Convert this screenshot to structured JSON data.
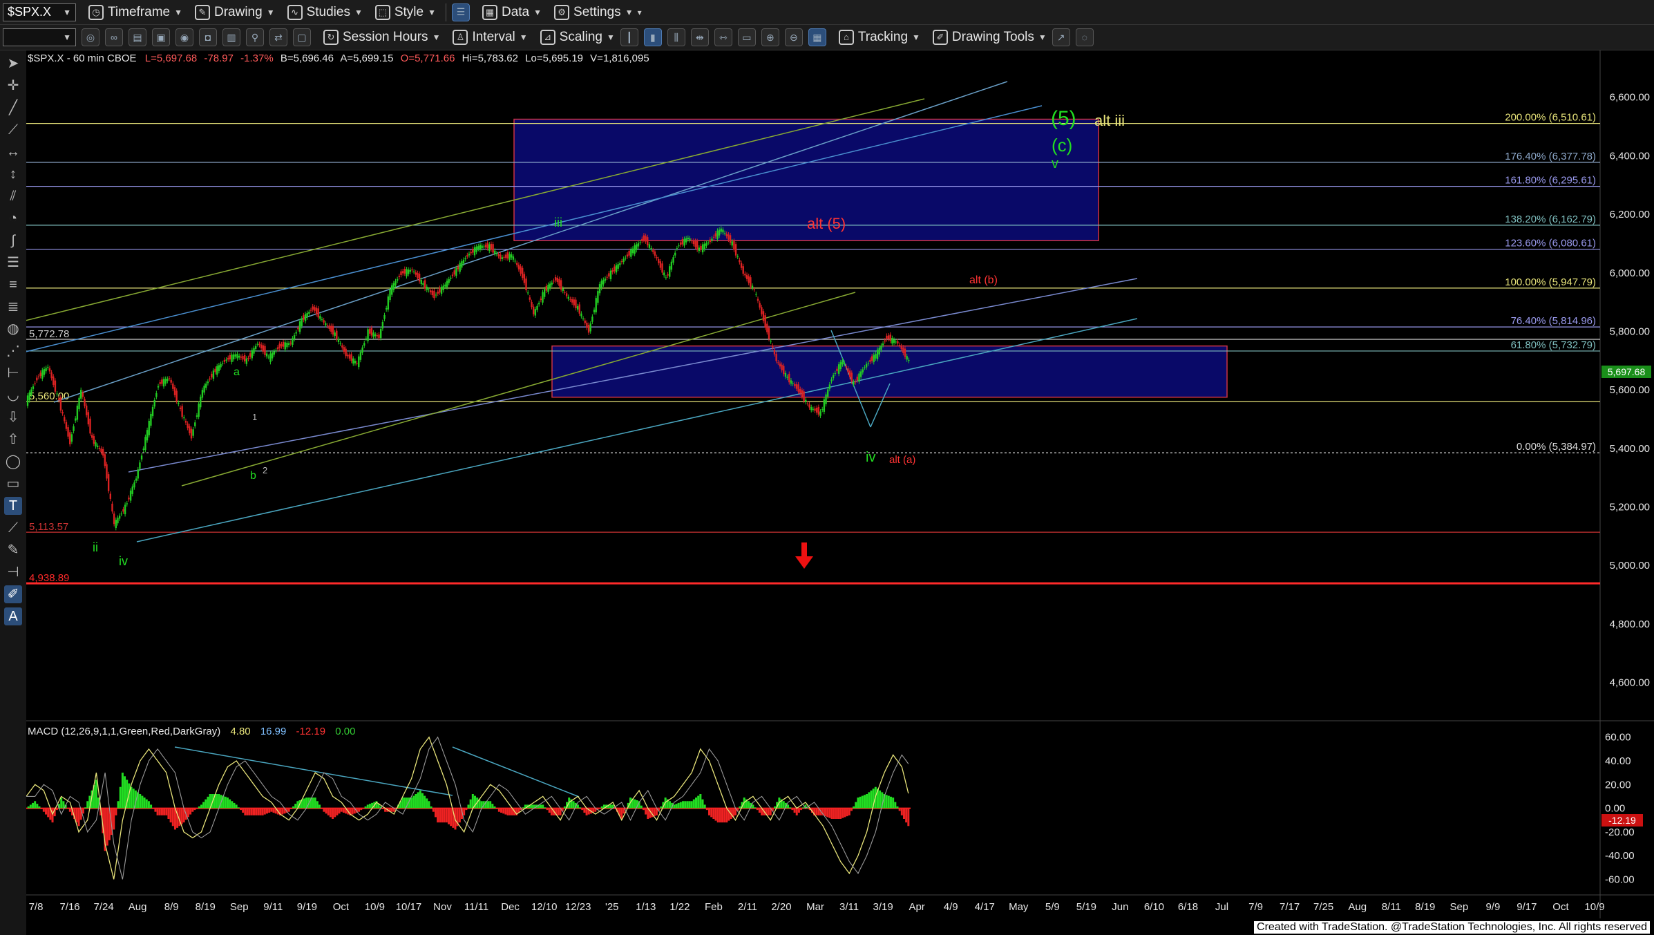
{
  "toolbar1": {
    "symbol": "$SPX.X",
    "items": [
      "Timeframe",
      "Drawing",
      "Studies",
      "Style",
      "Data",
      "Settings"
    ]
  },
  "toolbar2": {
    "items": [
      "Session Hours",
      "Interval",
      "Scaling",
      "Tracking",
      "Drawing Tools"
    ]
  },
  "footer": "Created with TradeStation. @TradeStation Technologies, Inc. All rights reserved",
  "chart_data": [
    {
      "type": "line",
      "title": "$SPX.X - 60 min  CBOE",
      "quote": {
        "L": "5,697.68",
        "chg": "-78.97",
        "pct": "-1.37%",
        "B": "5,696.46",
        "A": "5,699.15",
        "O": "5,771.66",
        "Hi": "5,783.62",
        "Lo": "5,695.19",
        "V": "1,816,095"
      },
      "last_price": "5,697.68",
      "y_axis_labels": [
        "6,600.00",
        "6,400.00",
        "6,200.00",
        "6,000.00",
        "5,800.00",
        "5,600.00",
        "5,400.00",
        "5,200.00",
        "5,000.00",
        "4,800.00",
        "4,600.00"
      ],
      "ylim": [
        4540,
        6760
      ],
      "x_tick_labels": [
        "7/8",
        "7/16",
        "7/24",
        "Aug",
        "8/9",
        "8/19",
        "Sep",
        "9/11",
        "9/19",
        "Oct",
        "10/9",
        "10/17",
        "Nov",
        "11/11",
        "Dec",
        "12/10",
        "12/23",
        "'25",
        "1/13",
        "1/22",
        "Feb",
        "2/11",
        "2/20",
        "Mar",
        "3/11",
        "3/19",
        "Apr",
        "4/9",
        "4/17",
        "May",
        "5/9",
        "5/19",
        "Jun",
        "6/10",
        "6/18",
        "Jul",
        "7/9",
        "7/17",
        "7/25",
        "Aug",
        "8/11",
        "8/19",
        "Sep",
        "9/9",
        "9/17",
        "Oct",
        "10/9"
      ],
      "fib_levels": [
        {
          "label": "200.00% (6,510.61)",
          "value": 6510.61,
          "color": "#e8e47a"
        },
        {
          "label": "176.40% (6,377.78)",
          "value": 6377.78,
          "color": "#8faacc"
        },
        {
          "label": "161.80% (6,295.61)",
          "value": 6295.61,
          "color": "#9a9aee"
        },
        {
          "label": "138.20% (6,162.79)",
          "value": 6162.79,
          "color": "#7fbfbf"
        },
        {
          "label": "123.60% (6,080.61)",
          "value": 6080.61,
          "color": "#9a9aee"
        },
        {
          "label": "100.00% (5,947.79)",
          "value": 5947.79,
          "color": "#e8e47a"
        },
        {
          "label": "76.40% (5,814.96)",
          "value": 5814.96,
          "color": "#9a9aee"
        },
        {
          "label": "61.80% (5,732.79)",
          "value": 5732.79,
          "color": "#7fbfbf"
        },
        {
          "label": "0.00% (5,384.97)",
          "value": 5384.97,
          "color": "#dddddd"
        }
      ],
      "price_levels": [
        {
          "label": "5,772.78",
          "value": 5772.78,
          "color": "#cccccc"
        },
        {
          "label": "5,560.00",
          "value": 5560.0,
          "color": "#e8e47a"
        },
        {
          "label": "5,113.57",
          "value": 5113.57,
          "color": "#cc3333"
        },
        {
          "label": "4,938.89",
          "value": 4938.89,
          "color": "#ff2a2a"
        }
      ],
      "price_path": [
        5560,
        5640,
        5680,
        5560,
        5420,
        5600,
        5430,
        5380,
        5140,
        5200,
        5300,
        5460,
        5620,
        5640,
        5530,
        5440,
        5600,
        5660,
        5700,
        5720,
        5700,
        5760,
        5710,
        5750,
        5760,
        5840,
        5880,
        5830,
        5790,
        5720,
        5690,
        5800,
        5780,
        5940,
        6000,
        6010,
        5960,
        5920,
        5960,
        6010,
        6060,
        6090,
        6090,
        6050,
        6060,
        5990,
        5860,
        5940,
        5980,
        5920,
        5880,
        5800,
        5960,
        6000,
        6040,
        6080,
        6120,
        6060,
        5980,
        6090,
        6120,
        6080,
        6110,
        6150,
        6100,
        6000,
        5940,
        5820,
        5700,
        5640,
        5600,
        5540,
        5520,
        5640,
        5700,
        5620,
        5680,
        5720,
        5780,
        5760,
        5697.68
      ],
      "zones": [
        {
          "name": "target-zone-upper",
          "top": 6525,
          "bottom": 6110
        },
        {
          "name": "support-zone",
          "top": 5750,
          "bottom": 5575
        }
      ],
      "annotations": [
        {
          "text": "(5)",
          "color": "#22dd22"
        },
        {
          "text": "alt iii",
          "color": "#e8e47a"
        },
        {
          "text": "(c)",
          "color": "#22dd22"
        },
        {
          "text": "v",
          "color": "#22dd22"
        },
        {
          "text": "iii",
          "color": "#22dd22"
        },
        {
          "text": "alt (5)",
          "color": "#ff3333"
        },
        {
          "text": "alt (b)",
          "color": "#ff3333"
        },
        {
          "text": "a",
          "color": "#22dd22"
        },
        {
          "text": "1",
          "color": "#bbbbbb"
        },
        {
          "text": "b",
          "color": "#22dd22"
        },
        {
          "text": "2",
          "color": "#bbbbbb"
        },
        {
          "text": "ii",
          "color": "#22dd22"
        },
        {
          "text": "iv",
          "color": "#22dd22"
        },
        {
          "text": "iv",
          "color": "#22dd22"
        },
        {
          "text": "alt (a)",
          "color": "#ff3333"
        }
      ]
    },
    {
      "type": "line",
      "title": "MACD (12,26,9,1,1,Green,Red,DarkGray)",
      "values_text": [
        "4.80",
        "16.99",
        "-12.19",
        "0.00"
      ],
      "values_colors": [
        "#e8e47a",
        "#7fbfff",
        "#ff3333",
        "#33cc33"
      ],
      "y_axis_labels": [
        "60.00",
        "40.00",
        "20.00",
        "0.00",
        "-20.00",
        "-40.00",
        "-60.00"
      ],
      "ylim": [
        -72,
        68
      ],
      "last_value": "-12.19",
      "macd_path": [
        10,
        20,
        15,
        -5,
        10,
        5,
        -20,
        -10,
        30,
        -30,
        -60,
        -10,
        20,
        40,
        50,
        40,
        30,
        0,
        -20,
        -25,
        -20,
        0,
        20,
        35,
        40,
        30,
        20,
        10,
        5,
        -5,
        -10,
        0,
        15,
        30,
        25,
        10,
        5,
        -5,
        -10,
        -5,
        5,
        0,
        -5,
        10,
        25,
        50,
        60,
        40,
        20,
        -10,
        -20,
        0,
        10,
        20,
        15,
        5,
        -5,
        0,
        5,
        10,
        0,
        -10,
        5,
        10,
        0,
        -5,
        0,
        5,
        -10,
        5,
        15,
        0,
        -10,
        5,
        10,
        20,
        30,
        50,
        40,
        20,
        0,
        -10,
        5,
        10,
        0,
        -10,
        5,
        10,
        0,
        5,
        -5,
        -15,
        -30,
        -45,
        -55,
        -40,
        -20,
        10,
        30,
        45,
        35,
        5
      ]
    }
  ]
}
